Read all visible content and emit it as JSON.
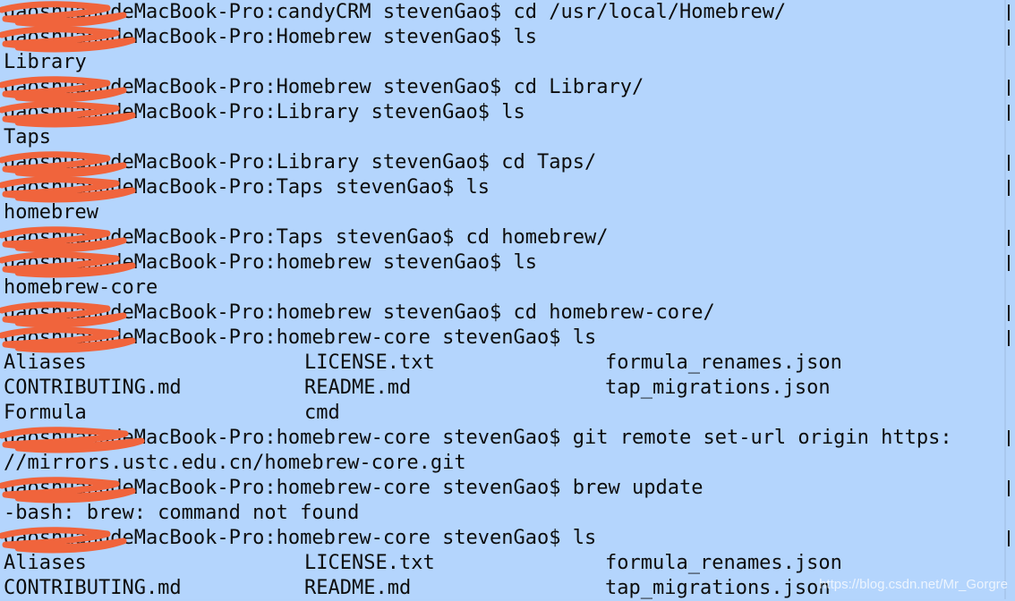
{
  "terminal": {
    "lines": [
      {
        "type": "cmd",
        "text": "gaoshuangdeMacBook-Pro:candyCRM stevenGao$ cd /usr/local/Homebrew/"
      },
      {
        "type": "cmd",
        "text": "gaoshuangdeMacBook-Pro:Homebrew stevenGao$ ls"
      },
      {
        "type": "out",
        "text": "Library"
      },
      {
        "type": "cmd",
        "text": "gaoshuangdeMacBook-Pro:Homebrew stevenGao$ cd Library/"
      },
      {
        "type": "cmd",
        "text": "gaoshuangdeMacBook-Pro:Library stevenGao$ ls"
      },
      {
        "type": "out",
        "text": "Taps"
      },
      {
        "type": "cmd",
        "text": "gaoshuangdeMacBook-Pro:Library stevenGao$ cd Taps/"
      },
      {
        "type": "cmd",
        "text": "gaoshuangdeMacBook-Pro:Taps stevenGao$ ls"
      },
      {
        "type": "out",
        "text": "homebrew"
      },
      {
        "type": "cmd",
        "text": "gaoshuangdeMacBook-Pro:Taps stevenGao$ cd homebrew/"
      },
      {
        "type": "cmd",
        "text": "gaoshuangdeMacBook-Pro:homebrew stevenGao$ ls"
      },
      {
        "type": "out",
        "text": "homebrew-core"
      },
      {
        "type": "cmd",
        "text": "gaoshuangdeMacBook-Pro:homebrew stevenGao$ cd homebrew-core/"
      },
      {
        "type": "cmd",
        "text": "gaoshuangdeMacBook-Pro:homebrew-core stevenGao$ ls"
      },
      {
        "type": "cols",
        "cols": [
          "Aliases",
          "LICENSE.txt",
          "formula_renames.json"
        ]
      },
      {
        "type": "cols",
        "cols": [
          "CONTRIBUTING.md",
          "README.md",
          "tap_migrations.json"
        ]
      },
      {
        "type": "cols",
        "cols": [
          "Formula",
          "cmd",
          ""
        ]
      },
      {
        "type": "cmd",
        "text": "gaoshuangdeMacBook-Pro:homebrew-core stevenGao$ git remote set-url origin https:"
      },
      {
        "type": "out",
        "text": "//mirrors.ustc.edu.cn/homebrew-core.git"
      },
      {
        "type": "cmd",
        "text": "gaoshuangdeMacBook-Pro:homebrew-core stevenGao$ brew update"
      },
      {
        "type": "out",
        "text": "-bash: brew: command not found"
      },
      {
        "type": "cmd",
        "text": "gaoshuangdeMacBook-Pro:homebrew-core stevenGao$ ls"
      },
      {
        "type": "cols",
        "cols": [
          "Aliases",
          "LICENSE.txt",
          "formula_renames.json"
        ]
      },
      {
        "type": "cols",
        "cols": [
          "CONTRIBUTING.md",
          "README.md",
          "tap_migrations.json"
        ]
      }
    ]
  },
  "watermark": "https://blog.csdn.net/Mr_Gorgre",
  "colors": {
    "background": "#b4d5fd",
    "text": "#0d0d0d",
    "redaction": "#f0643c"
  }
}
